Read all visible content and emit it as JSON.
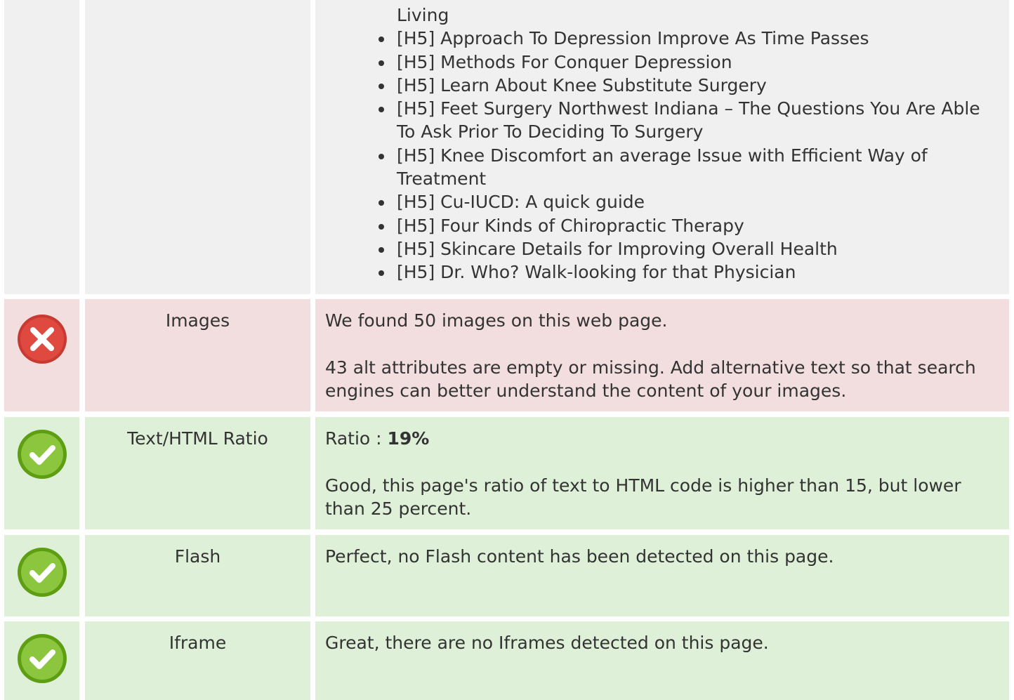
{
  "headings": {
    "partial_first_line": "Living",
    "items": [
      "[H5] Approach To Depression Improve As Time Passes",
      "[H5] Methods For Conquer Depression",
      "[H5] Learn About Knee Substitute Surgery",
      "[H5] Feet Surgery Northwest Indiana – The Questions You Are Able To Ask Prior To Deciding To Surgery",
      "[H5] Knee Discomfort an average Issue with Efficient Way of Treatment",
      "[H5] Cu-IUCD: A quick guide",
      "[H5] Four Kinds of Chiropractic Therapy",
      "[H5] Skincare Details for Improving Overall Health",
      "[H5] Dr. Who? Walk-looking for that Physician"
    ]
  },
  "rows": {
    "images": {
      "status": "error",
      "status_icon": "error-x-icon",
      "label": "Images",
      "line1": "We found 50 images on this web page.",
      "line2": "43 alt attributes are empty or missing. Add alternative text so that search engines can better understand the content of your images."
    },
    "ratio": {
      "status": "ok",
      "status_icon": "check-icon",
      "label": "Text/HTML Ratio",
      "line1_prefix": "Ratio : ",
      "line1_value": "19%",
      "line2": "Good, this page's ratio of text to HTML code is higher than 15, but lower than 25 percent."
    },
    "flash": {
      "status": "ok",
      "status_icon": "check-icon",
      "label": "Flash",
      "line1": "Perfect, no Flash content has been detected on this page."
    },
    "iframe": {
      "status": "ok",
      "status_icon": "check-icon",
      "label": "Iframe",
      "line1": "Great, there are no Iframes detected on this page."
    }
  },
  "colors": {
    "error_bg": "#f2dede",
    "ok_bg": "#dff0d8",
    "neutral_bg": "#f0f0f0",
    "error_icon": "#d9534f",
    "ok_icon": "#7fbf2a"
  }
}
